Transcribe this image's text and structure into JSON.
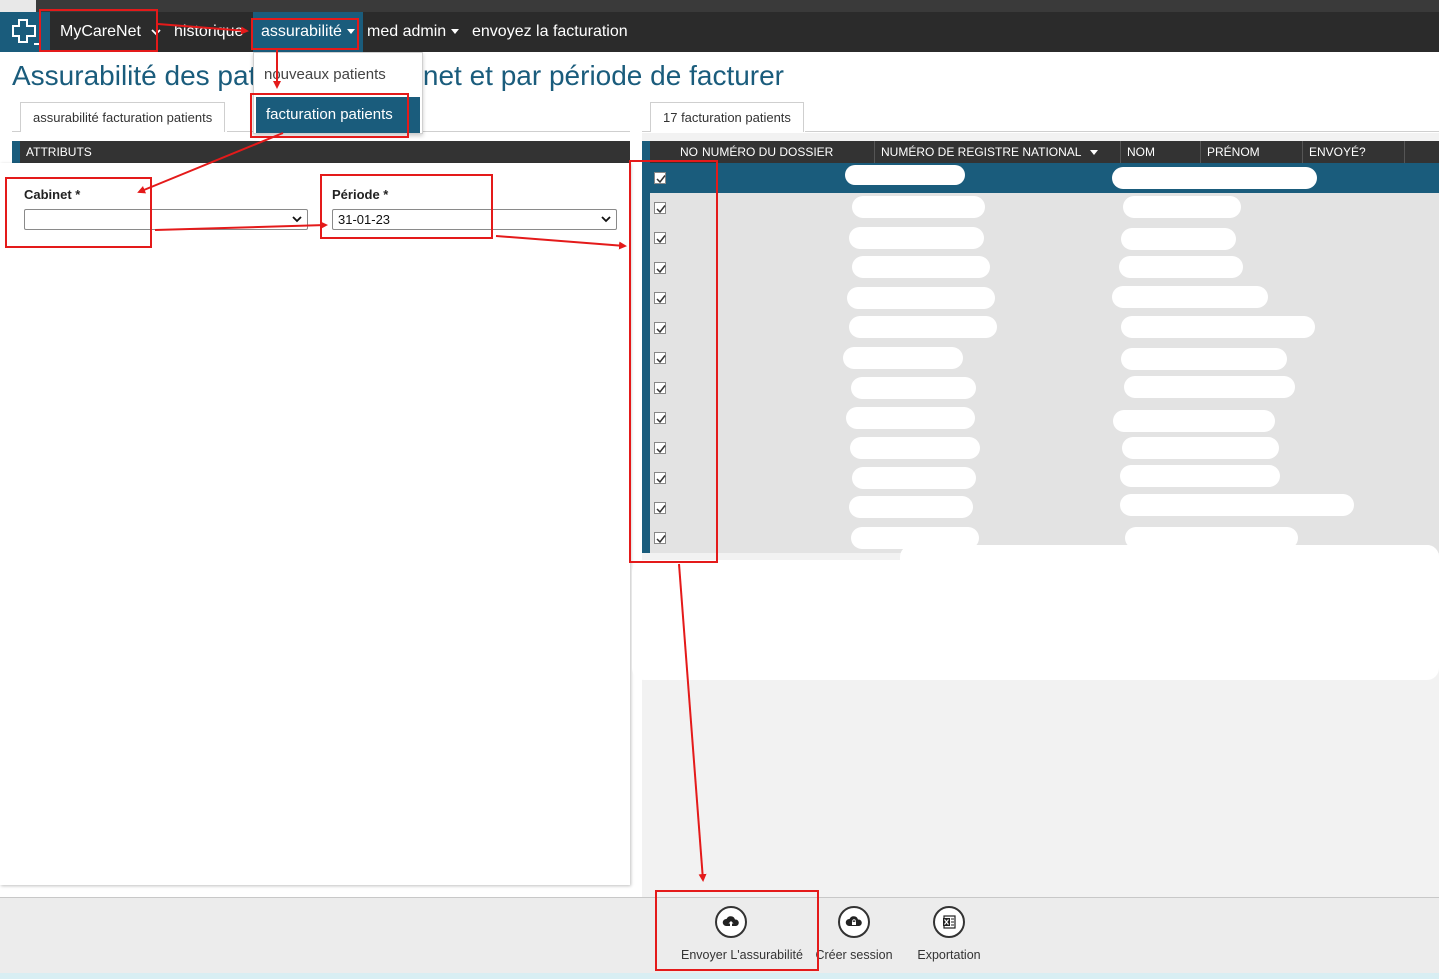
{
  "navbar": {
    "brand": "MyCareNet",
    "items": [
      {
        "label": "historique"
      },
      {
        "label": "assurabilité"
      },
      {
        "label": "med admin"
      },
      {
        "label": "envoyez la facturation"
      }
    ]
  },
  "dropdown": {
    "items": [
      {
        "label": "nouveaux patients"
      },
      {
        "label": "facturation patients"
      }
    ]
  },
  "page_title": "Assurabilité des patients par cabinet et par période de facturer",
  "left": {
    "tab_label": "assurabilité facturation patients",
    "section_header": "ATTRIBUTS",
    "cabinet_label": "Cabinet *",
    "cabinet_value": "",
    "periode_label": "Période *",
    "periode_value": "31-01-23"
  },
  "right": {
    "tab_label": "17 facturation patients",
    "columns": [
      "NO",
      "NUMÉRO DU DOSSIER",
      "NUMÉRO DE REGISTRE NATIONAL",
      "NOM",
      "PRÉNOM",
      "ENVOYÉ?"
    ],
    "row_count": 13,
    "checked": [
      true,
      true,
      true,
      true,
      true,
      true,
      true,
      true,
      true,
      true,
      true,
      true,
      true
    ]
  },
  "toolbar": {
    "buttons": [
      {
        "label": "Envoyer L'assurabilité",
        "icon": "cloud-upload-icon"
      },
      {
        "label": "Créer session",
        "icon": "cloud-lock-icon"
      },
      {
        "label": "Exportation",
        "icon": "excel-icon"
      }
    ]
  },
  "annotation_color": "#e41a1a",
  "accent_color": "#1a5c7c"
}
